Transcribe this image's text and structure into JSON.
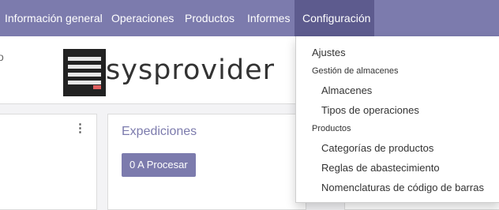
{
  "navbar": {
    "items": [
      {
        "label": "Información general"
      },
      {
        "label": "Operaciones"
      },
      {
        "label": "Productos"
      },
      {
        "label": "Informes"
      },
      {
        "label": "Configuración"
      }
    ]
  },
  "header": {
    "cut_text": "o",
    "logo_text": "sysprovider"
  },
  "cards": {
    "center_title": "Expediciones",
    "process_button": "0 A Procesar",
    "left_menu_glyph": "⋮"
  },
  "dropdown": {
    "settings": "Ajustes",
    "warehouse_section": "Gestión de almacenes",
    "warehouses": "Almacenes",
    "operation_types": "Tipos de operaciones",
    "products_section": "Productos",
    "product_categories": "Categorías de productos",
    "reorder_rules": "Reglas de abastecimiento",
    "barcode_nomenclatures": "Nomenclaturas de código de barras"
  },
  "colors": {
    "navbar": "#7c7bad",
    "navbar_active": "#5d5b8e",
    "accent": "#7c7bad"
  }
}
